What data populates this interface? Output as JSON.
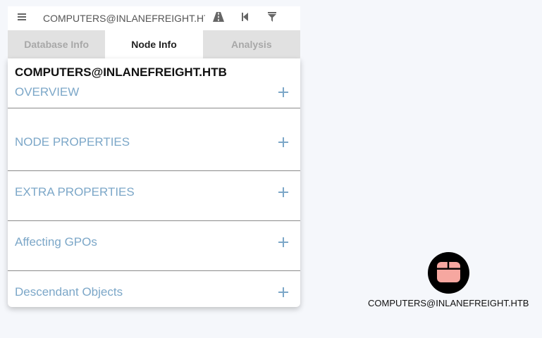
{
  "search": {
    "value": "COMPUTERS@INLANEFREIGHT.HTB"
  },
  "toolbar": {
    "menu_icon": "hamburger-menu-icon",
    "pathfinding_icon": "road-icon",
    "back_icon": "step-backward-icon",
    "filter_icon": "filter-icon"
  },
  "tabs": [
    {
      "label": "Database Info",
      "active": false
    },
    {
      "label": "Node Info",
      "active": true
    },
    {
      "label": "Analysis",
      "active": false
    }
  ],
  "panel": {
    "node_name": "COMPUTERS@INLANEFREIGHT.HTB",
    "sections": [
      {
        "title": "OVERVIEW"
      },
      {
        "title": "NODE PROPERTIES"
      },
      {
        "title": "EXTRA PROPERTIES"
      },
      {
        "title": "Affecting GPOs"
      },
      {
        "title": "Descendant Objects"
      }
    ]
  },
  "graph": {
    "node_label": "COMPUTERS@INLANEFREIGHT.HTB",
    "node_icon": "container-box-icon"
  },
  "colors": {
    "background": "#f5f7fb",
    "section_title": "#7ca7c8",
    "tab_inactive_bg": "#e1e1e1",
    "tab_inactive_text": "#a8a8a8",
    "node_icon_fill": "#f6a7a0"
  }
}
